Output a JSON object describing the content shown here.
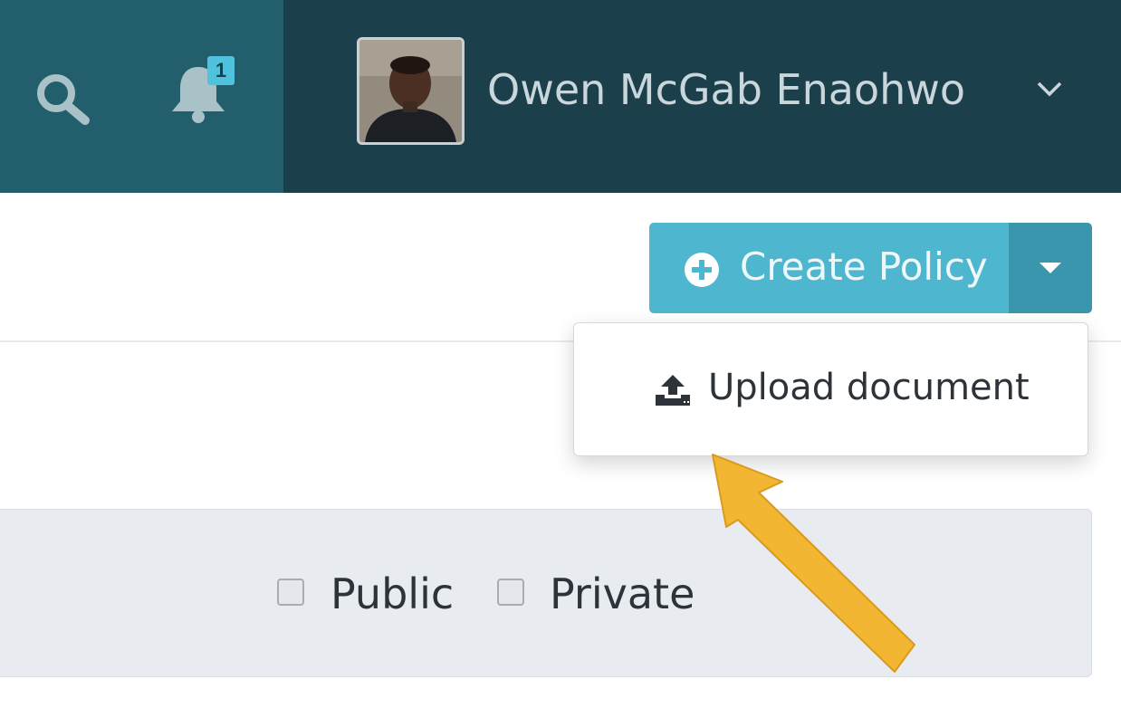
{
  "header": {
    "notification_count": "1",
    "user_name": "Owen McGab Enaohwo",
    "icons": [
      "search-icon",
      "bell-icon",
      "chevron-down-icon"
    ],
    "colors": {
      "left_bg": "#235e6c",
      "right_bg": "#1b3f4b",
      "badge": "#4fc3dd"
    }
  },
  "toolbar": {
    "create_label": "Create Policy",
    "icons": [
      "plus-circle-icon",
      "caret-down-icon"
    ],
    "colors": {
      "primary": "#4eb6ce",
      "caret": "#3a96ad"
    }
  },
  "dropdown": {
    "items": [
      {
        "label": "Upload document",
        "icon": "upload-icon"
      }
    ]
  },
  "filters": {
    "options": [
      {
        "label": "Public",
        "checked": false
      },
      {
        "label": "Private",
        "checked": false
      }
    ]
  },
  "annotation": {
    "arrow_color": "#f2b632"
  }
}
